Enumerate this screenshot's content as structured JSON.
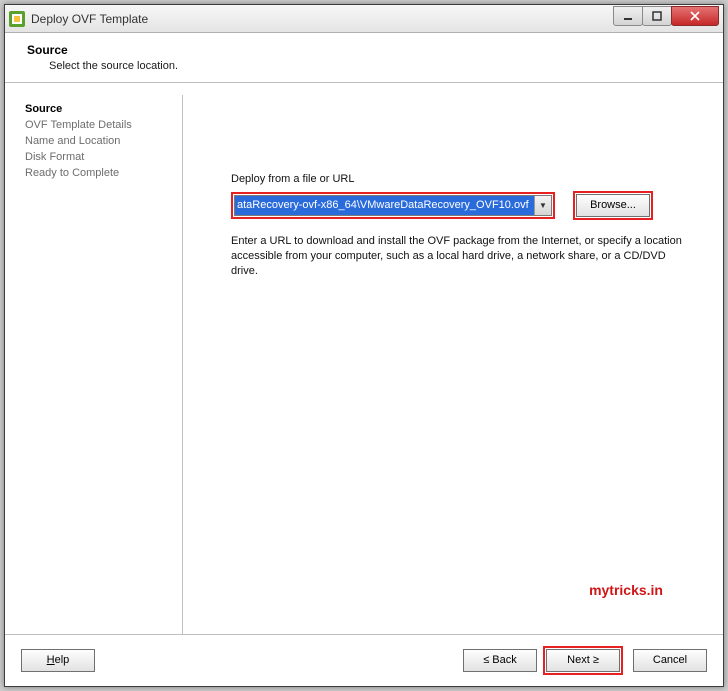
{
  "window": {
    "title": "Deploy OVF Template"
  },
  "header": {
    "title": "Source",
    "subtitle": "Select the source location."
  },
  "sidebar": {
    "items": [
      {
        "label": "Source",
        "active": true
      },
      {
        "label": "OVF Template Details",
        "active": false
      },
      {
        "label": "Name and Location",
        "active": false
      },
      {
        "label": "Disk Format",
        "active": false
      },
      {
        "label": "Ready to Complete",
        "active": false
      }
    ]
  },
  "main": {
    "field_label": "Deploy from a file or URL",
    "path_value": "ataRecovery-ovf-x86_64\\VMwareDataRecovery_OVF10.ovf",
    "browse_label": "Browse...",
    "hint": "Enter a URL to download and install the OVF package from the Internet, or specify a location accessible from your computer, such as a local hard drive, a network share, or a CD/DVD drive."
  },
  "watermark": "mytricks.in",
  "footer": {
    "help": "Help",
    "back": "≤ Back",
    "next": "Next ≥",
    "cancel": "Cancel"
  }
}
